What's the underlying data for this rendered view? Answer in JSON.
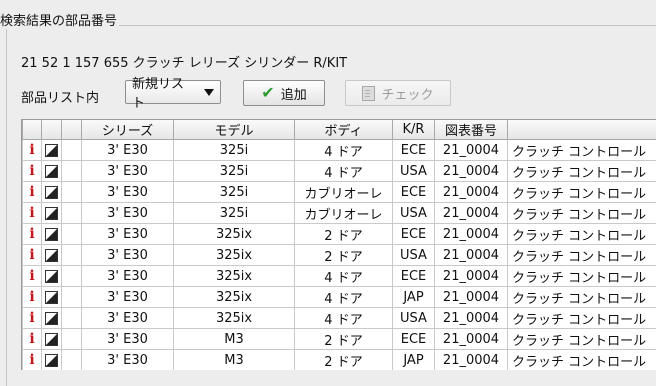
{
  "panel": {
    "title": "検索結果の部品番号"
  },
  "part": {
    "description": "21 52 1 157 655 クラッチ レリーズ シリンダー R/KIT"
  },
  "controls": {
    "list_label": "部品リスト内",
    "dropdown_value": "新規リスト",
    "add_label": "追加",
    "check_label": "チェック"
  },
  "table": {
    "headers": [
      "",
      "",
      "",
      "シリーズ",
      "モデル",
      "ボディ",
      "K/R",
      "図表番号",
      ""
    ],
    "rows": [
      [
        "3' E30",
        "325i",
        "4 ドア",
        "ECE",
        "21_0004",
        "クラッチ コントロール"
      ],
      [
        "3' E30",
        "325i",
        "4 ドア",
        "USA",
        "21_0004",
        "クラッチ コントロール"
      ],
      [
        "3' E30",
        "325i",
        "カブリオーレ",
        "ECE",
        "21_0004",
        "クラッチ コントロール"
      ],
      [
        "3' E30",
        "325i",
        "カブリオーレ",
        "USA",
        "21_0004",
        "クラッチ コントロール"
      ],
      [
        "3' E30",
        "325ix",
        "2 ドア",
        "ECE",
        "21_0004",
        "クラッチ コントロール"
      ],
      [
        "3' E30",
        "325ix",
        "2 ドア",
        "USA",
        "21_0004",
        "クラッチ コントロール"
      ],
      [
        "3' E30",
        "325ix",
        "4 ドア",
        "ECE",
        "21_0004",
        "クラッチ コントロール"
      ],
      [
        "3' E30",
        "325ix",
        "4 ドア",
        "JAP",
        "21_0004",
        "クラッチ コントロール"
      ],
      [
        "3' E30",
        "325ix",
        "4 ドア",
        "USA",
        "21_0004",
        "クラッチ コントロール"
      ],
      [
        "3' E30",
        "M3",
        "2 ドア",
        "ECE",
        "21_0004",
        "クラッチ コントロール"
      ],
      [
        "3' E30",
        "M3",
        "2 ドア",
        "JAP",
        "21_0004",
        "クラッチ コントロール"
      ]
    ]
  },
  "icons": {
    "info": "i",
    "accent": "#c4161c"
  }
}
